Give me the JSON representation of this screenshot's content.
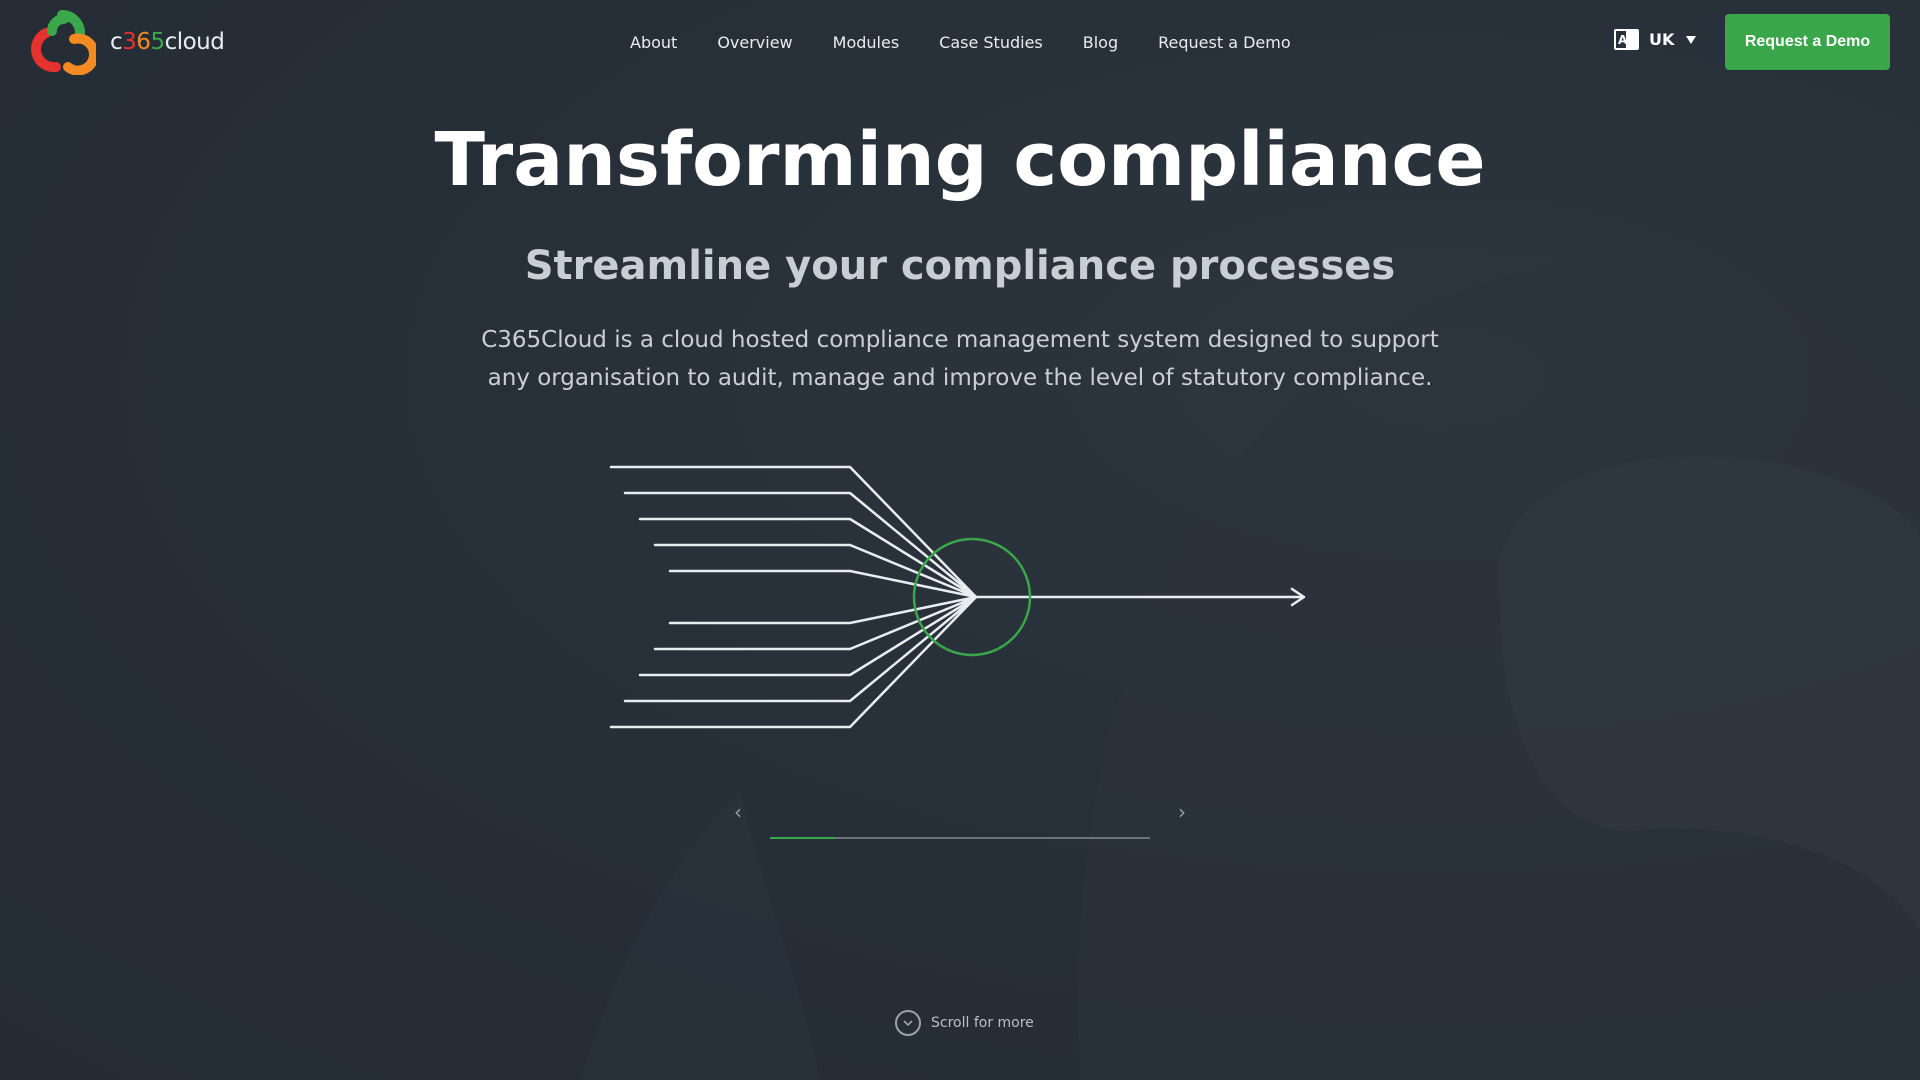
{
  "header": {
    "logo_wordmark": {
      "c": "c",
      "three": "3",
      "six": "6",
      "five": "5",
      "cloud": "cloud"
    },
    "nav": [
      "About",
      "Overview",
      "Modules",
      "Case Studies",
      "Blog",
      "Request a Demo"
    ],
    "language": {
      "code": "UK",
      "icon": "translate-icon"
    },
    "cta_label": "Request a Demo"
  },
  "hero": {
    "title": "Transforming compliance",
    "subtitle": "Streamline your compliance processes",
    "description": "C365Cloud is a cloud hosted compliance management system designed to support any organisation to audit, manage and improve the level of statutory compliance."
  },
  "carousel": {
    "prev_icon": "chevron-left-icon",
    "next_icon": "chevron-right-icon",
    "progress": 0.17
  },
  "scroll": {
    "label": "Scroll for more",
    "icon": "chevron-down-circle-icon"
  },
  "colors": {
    "background": "#262e38",
    "accent_green": "#3aa64a",
    "logo_red": "#e5322f",
    "logo_orange": "#f38b22",
    "logo_green": "#3aa84a"
  }
}
